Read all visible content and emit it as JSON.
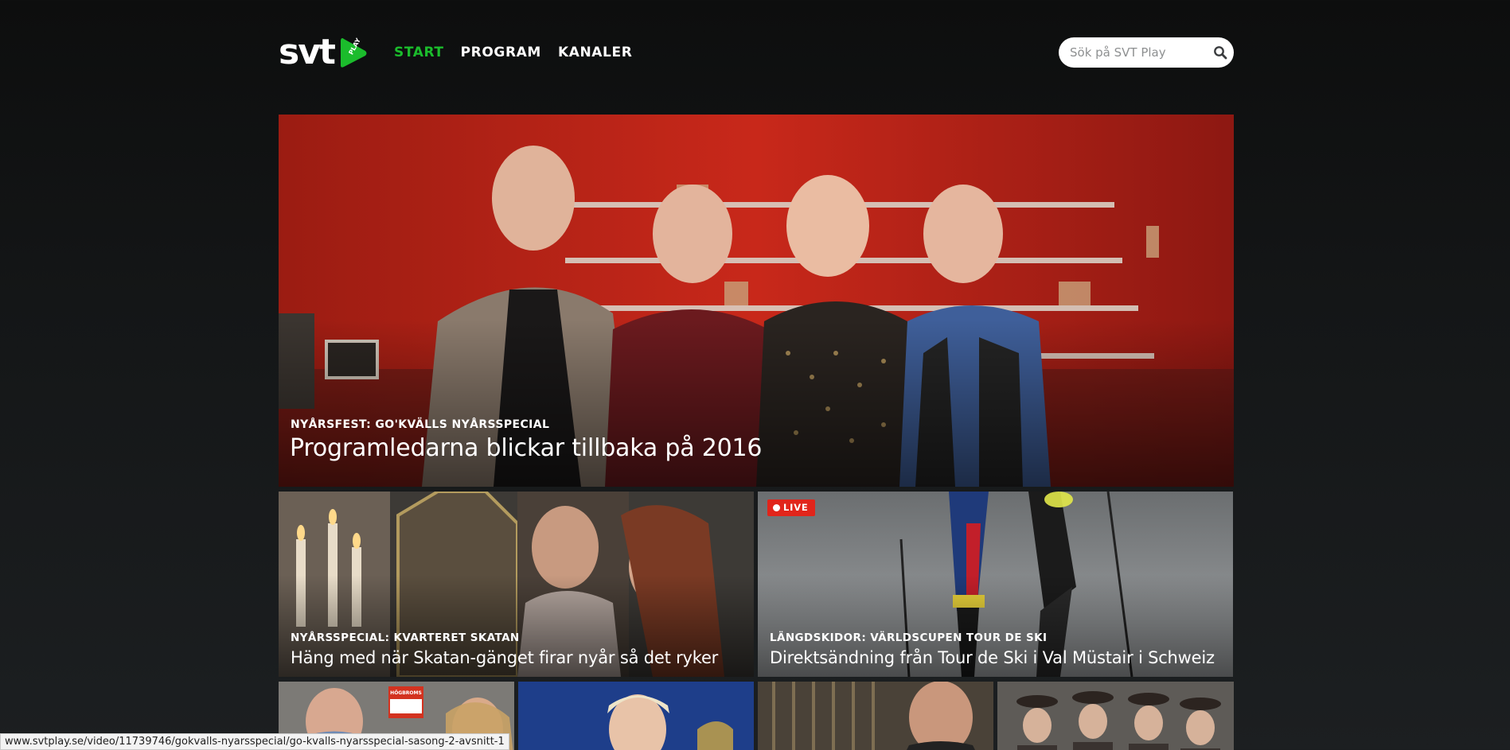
{
  "brand": {
    "logo_text": "svt",
    "logo_badge": "PLAY",
    "accent": "#1bbc2c"
  },
  "nav": {
    "items": [
      {
        "label": "START",
        "active": true
      },
      {
        "label": "PROGRAM",
        "active": false
      },
      {
        "label": "KANALER",
        "active": false
      }
    ]
  },
  "search": {
    "placeholder": "Sök på SVT Play",
    "value": "",
    "icon": "search-icon"
  },
  "hero": {
    "kicker": "NYÅRSFEST: GO'KVÄLLS NYÅRSSPECIAL",
    "title": "Programledarna blickar tillbaka på 2016"
  },
  "cards": [
    {
      "kicker": "NYÅRSSPECIAL: KVARTERET SKATAN",
      "title": "Häng med när Skatan-gänget firar nyår så det ryker"
    },
    {
      "kicker": "LÄNGDSKIDOR: VÄRLDSCUPEN TOUR DE SKI",
      "title": "Direktsändning från Tour de Ski i Val Müstair i Schweiz",
      "badge": "LIVE",
      "badge_color": "#e1251b"
    }
  ],
  "small_cards": [
    {
      "sign_text": "HÖGBROMS"
    },
    {},
    {},
    {}
  ],
  "statusbar": {
    "url": "www.svtplay.se/video/11739746/gokvalls-nyarsspecial/go-kvalls-nyarsspecial-sasong-2-avsnitt-1"
  }
}
